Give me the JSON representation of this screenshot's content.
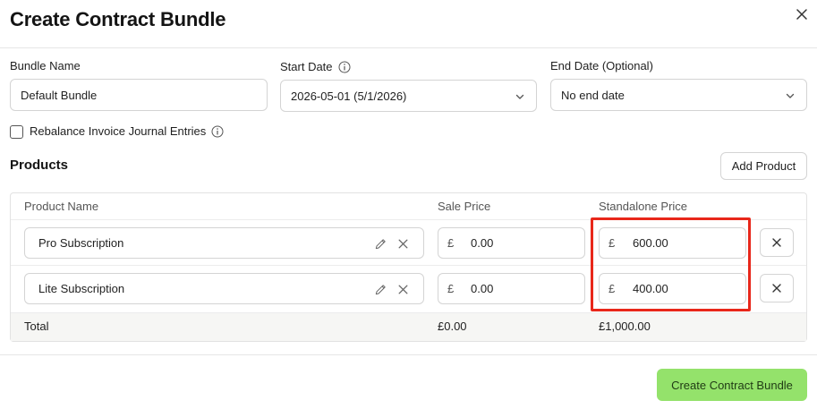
{
  "dialog": {
    "title": "Create Contract Bundle",
    "submit_label": "Create Contract Bundle"
  },
  "form": {
    "bundle_name": {
      "label": "Bundle Name",
      "value": "Default Bundle"
    },
    "start_date": {
      "label": "Start Date",
      "value": "2026-05-01 (5/1/2026)"
    },
    "end_date": {
      "label": "End Date (Optional)",
      "value": "No end date"
    },
    "rebalance": {
      "label": "Rebalance Invoice Journal Entries",
      "checked": false
    }
  },
  "products": {
    "title": "Products",
    "add_label": "Add Product",
    "columns": [
      "Product Name",
      "Sale Price",
      "Standalone Price"
    ],
    "rows": [
      {
        "name": "Pro Subscription",
        "currency": "£",
        "sale_price": "0.00",
        "standalone_price": "600.00"
      },
      {
        "name": "Lite Subscription",
        "currency": "£",
        "sale_price": "0.00",
        "standalone_price": "400.00"
      }
    ],
    "total": {
      "label": "Total",
      "sale": "£0.00",
      "standalone": "£1,000.00"
    }
  },
  "icons": {
    "close": "close-icon",
    "info": "info-icon",
    "chevron": "chevron-down-icon",
    "edit": "pencil-icon",
    "clear": "clear-x-icon",
    "remove": "remove-x-icon"
  },
  "colors": {
    "primary_button": "#94e26b",
    "highlight_box": "#e8271a"
  }
}
